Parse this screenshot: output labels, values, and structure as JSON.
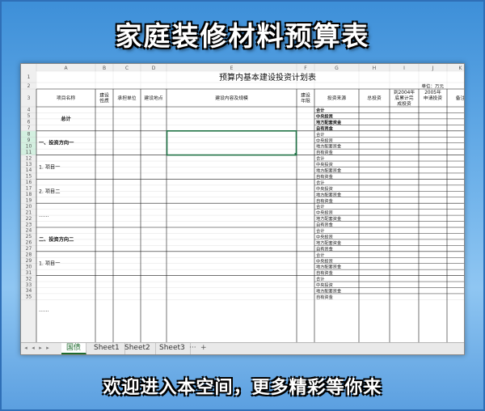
{
  "banner": {
    "title": "家庭装修材料预算表",
    "footer": "欢迎进入本空间，更多精彩等你来"
  },
  "spreadsheet": {
    "column_letters": [
      "A",
      "B",
      "C",
      "D",
      "E",
      "F",
      "G",
      "H",
      "I",
      "J",
      "K"
    ],
    "row_numbers": [
      "1",
      "2",
      "3",
      "4",
      "5",
      "6",
      "7",
      "8",
      "9",
      "10",
      "11",
      "12",
      "13",
      "14",
      "15",
      "16",
      "17",
      "18",
      "19",
      "20",
      "21",
      "22",
      "23",
      "24",
      "25",
      "26",
      "27",
      "28",
      "29",
      "30",
      "31",
      "32",
      "33",
      "34",
      "35"
    ],
    "title": "预算内基本建设投资计划表",
    "unit": "单位：万元",
    "headers": {
      "project_name": "项目名称",
      "build_nature": "建设性质",
      "undertaker": "承担单位",
      "location": "建设地点",
      "content_scale": "建设内容及规模",
      "build_years": "建设年限",
      "fund_source": "投资来源",
      "total_investment": "总投资",
      "cumulative_2004": "到2004年底累计完成投资",
      "apply_2005": "2005年申请投资",
      "remarks": "备注"
    },
    "row_labels": {
      "total": "总计",
      "direction_1": "一、投资方向一",
      "project_1": "1. 项目一",
      "project_2": "2. 项目二",
      "ellipsis_1": "……",
      "direction_2": "二、投资方向二",
      "project_1b": "1. 项目一",
      "ellipsis_2": "……"
    },
    "fund_items": [
      "合计",
      "中央投资",
      "地方配套资金",
      "自有资金"
    ],
    "last_fund_items": [
      "合计",
      "中央投资",
      "地方配套资金"
    ],
    "selected_cell": "E8:F11"
  },
  "sheet_tabs": [
    "国债",
    "Sheet1",
    "Sheet2",
    "Sheet3"
  ],
  "tab_more": "···",
  "tab_add": "+",
  "tab_nav": [
    "◂",
    "◂",
    "▸",
    "▸"
  ],
  "colors": {
    "selection": "#217346",
    "header_fill": "#efefef",
    "row_header_selected": "#d3f0e0"
  }
}
